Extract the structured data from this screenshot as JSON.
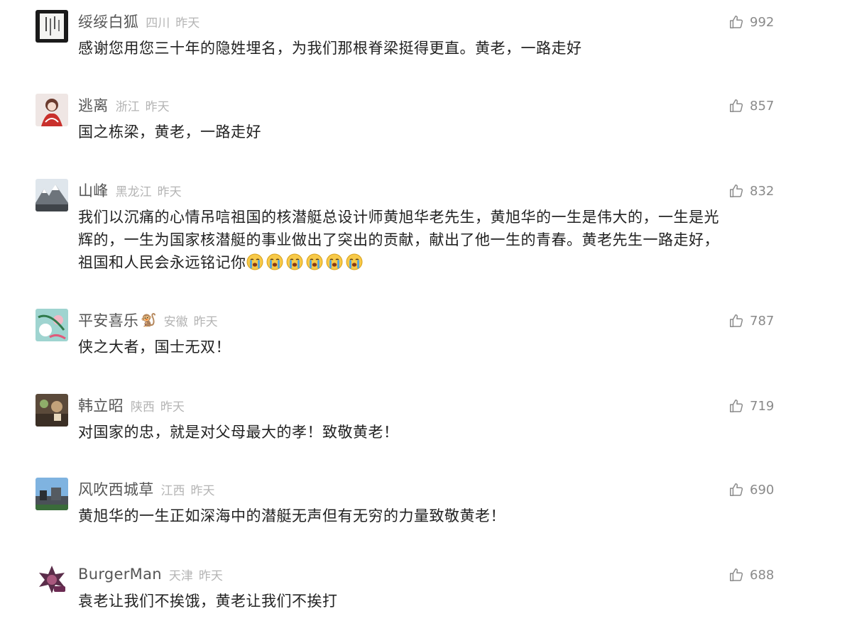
{
  "comments": [
    {
      "username": "绥绥白狐",
      "region": "四川",
      "time": "昨天",
      "likes": "992",
      "text": "感谢您用您三十年的隐姓埋名，为我们那根脊梁挺得更直。黄老，一路走好"
    },
    {
      "username": "逃离",
      "region": "浙江",
      "time": "昨天",
      "likes": "857",
      "text": "国之栋梁，黄老，一路走好"
    },
    {
      "username": "山峰",
      "region": "黑龙江",
      "time": "昨天",
      "likes": "832",
      "lines": [
        "我们以沉痛的心情吊唁祖国的核潜艇总设计师黄旭华老先生，黄旭华的一生是伟大的，一生是光",
        "辉的，一生为国家核潜艇的事业做出了突出的贡献，献出了他一生的青春。黄老先生一路走好，",
        "祖国和人民会永远铭记你"
      ],
      "emoji_count": 6,
      "emoji_name": "crying-face-emoji"
    },
    {
      "username": "平安喜乐",
      "username_emoji": "🐒",
      "region": "安徽",
      "time": "昨天",
      "likes": "787",
      "text": "侠之大者，国士无双！"
    },
    {
      "username": "韩立昭",
      "region": "陕西",
      "time": "昨天",
      "likes": "719",
      "text": "对国家的忠，就是对父母最大的孝！致敬黄老！"
    },
    {
      "username": "风吹西城草",
      "region": "江西",
      "time": "昨天",
      "likes": "690",
      "text": "黄旭华的一生正如深海中的潜艇无声但有无穷的力量致敬黄老！"
    },
    {
      "username": "BurgerMan",
      "region": "天津",
      "time": "昨天",
      "likes": "688",
      "text": "袁老让我们不挨饿，黄老让我们不挨打"
    }
  ],
  "colors": {
    "username": "#555555",
    "meta": "#b4b4b4",
    "text": "#222222",
    "like": "#8a8a8a"
  },
  "icons": {
    "like": "thumbs-up-icon"
  }
}
